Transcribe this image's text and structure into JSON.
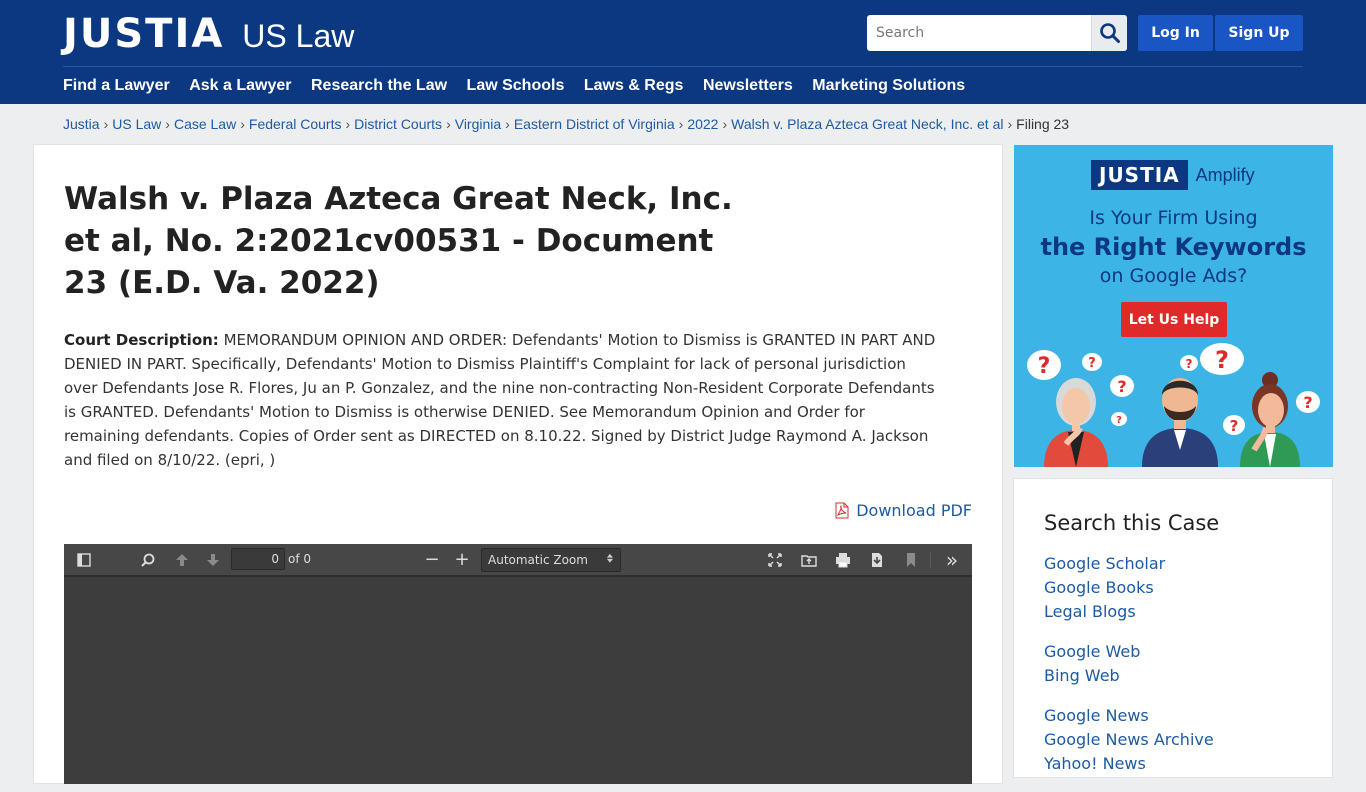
{
  "header": {
    "logo_main": "JUSTIA",
    "logo_sub": "US Law",
    "search_placeholder": "Search",
    "login_label": "Log In",
    "signup_label": "Sign Up",
    "nav": [
      "Find a Lawyer",
      "Ask a Lawyer",
      "Research the Law",
      "Law Schools",
      "Laws & Regs",
      "Newsletters",
      "Marketing Solutions"
    ]
  },
  "breadcrumb": {
    "links": [
      "Justia",
      "US Law",
      "Case Law",
      "Federal Courts",
      "District Courts",
      "Virginia",
      "Eastern District of Virginia",
      "2022",
      "Walsh v. Plaza Azteca Great Neck, Inc. et al"
    ],
    "current": "Filing 23",
    "separator": "›"
  },
  "main": {
    "title": "Walsh v. Plaza Azteca Great Neck, Inc. et al, No. 2:2021cv00531 - Document 23 (E.D. Va. 2022)",
    "desc_label": "Court Description:",
    "desc_text": " MEMORANDUM OPINION AND ORDER: Defendants' Motion to Dismiss is GRANTED IN PART AND DENIED IN PART. Specifically, Defendants' Motion to Dismiss Plaintiff's Complaint for lack of personal jurisdiction over Defendants Jose R. Flores, Ju an P. Gonzalez, and the nine non-contracting Non-Resident Corporate Defendants is GRANTED. Defendants' Motion to Dismiss is otherwise DENIED. See Memorandum Opinion and Order for remaining defendants. Copies of Order sent as DIRECTED on 8.10.22. Signed by District Judge Raymond A. Jackson and filed on 8/10/22. (epri, )",
    "download_label": "Download PDF"
  },
  "viewer": {
    "page_value": "0",
    "page_of": "of 0",
    "zoom": "Automatic Zoom",
    "zoom_out_symbol": "−",
    "zoom_in_symbol": "+",
    "more_symbol": "»",
    "zoom_arrow": "▲▼",
    "icons": [
      "sidebar-toggle-icon",
      "search-icon",
      "previous-page-icon",
      "next-page-icon",
      "zoom-out-icon",
      "zoom-in-icon",
      "presentation-mode-icon",
      "open-file-icon",
      "print-icon",
      "download-icon",
      "bookmark-icon",
      "tools-icon"
    ]
  },
  "ad": {
    "logo_box": "JUSTIA",
    "logo_amp": "Amplify",
    "line1": "Is Your Firm Using",
    "line2": "the Right Keywords",
    "line3": "on Google Ads?",
    "button": "Let Us Help",
    "question_mark": "?"
  },
  "sidebar": {
    "title": "Search this Case",
    "groups": [
      [
        "Google Scholar",
        "Google Books",
        "Legal Blogs"
      ],
      [
        "Google Web",
        "Bing Web"
      ],
      [
        "Google News",
        "Google News Archive",
        "Yahoo! News"
      ]
    ]
  },
  "colors": {
    "header_bg": "#0b3880",
    "button_blue": "#1a55c4",
    "link": "#1d5aa3",
    "ad_bg": "#3cb4e6",
    "ad_button": "#e02a2a",
    "viewer_bg": "#3d3d3d"
  }
}
